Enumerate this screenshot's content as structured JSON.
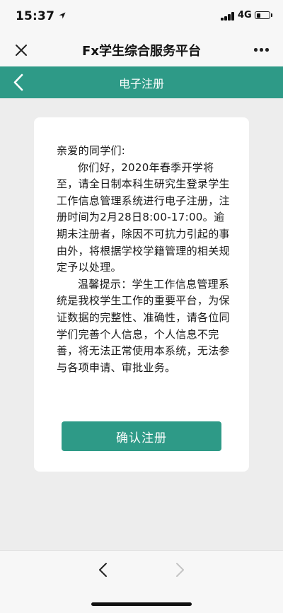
{
  "status_bar": {
    "time": "15:37",
    "network": "4G",
    "battery_level": 0.3
  },
  "wechat_nav": {
    "title": "Fx学生综合服务平台",
    "icons": {
      "close": "close-icon",
      "more": "more-icon"
    }
  },
  "header": {
    "title": "电子注册",
    "back_icon": "chevron-left-icon",
    "color": "#2e9a87"
  },
  "notice": {
    "greeting": "亲爱的同学们:",
    "paragraph1": "你们好，2020年春季开学将至，请全日制本科生研究生登录学生工作信息管理系统进行电子注册，注册时间为2月28日8:00-17:00。逾期未注册者，除因不可抗力引起的事由外，将根据学校学籍管理的相关规定予以处理。",
    "paragraph2": "温馨提示：学生工作信息管理系统是我校学生工作的重要平台，为保证数据的完整性、准确性，请各位同学们完善个人信息，个人信息不完善，将无法正常使用本系统，无法参与各项申请、审批业务。"
  },
  "confirm_label": "确认注册",
  "bottom_bar": {
    "back_icon": "chevron-left-icon",
    "forward_icon": "chevron-right-icon"
  }
}
